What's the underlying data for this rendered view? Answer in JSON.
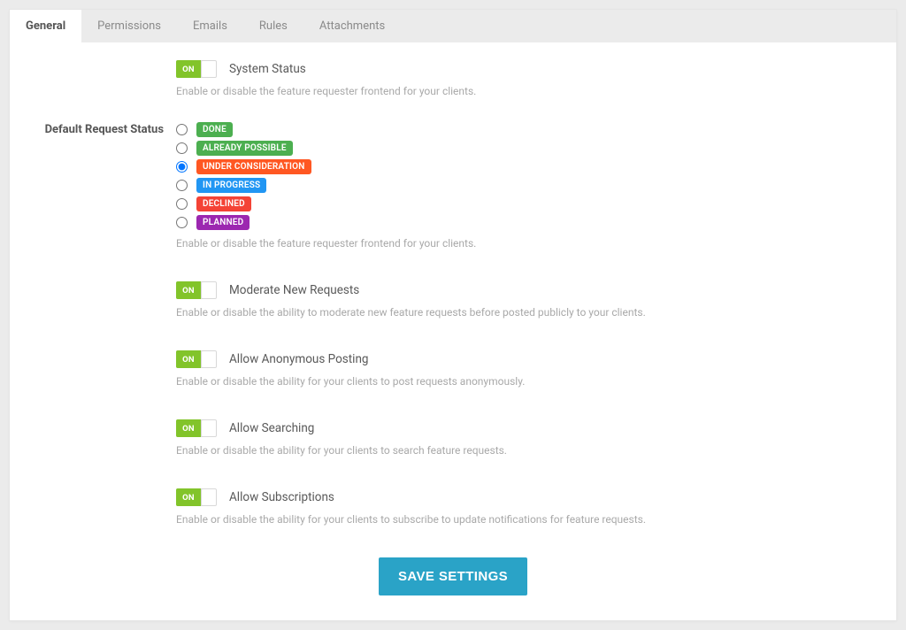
{
  "tabs": {
    "items": [
      {
        "label": "General",
        "active": true
      },
      {
        "label": "Permissions",
        "active": false
      },
      {
        "label": "Emails",
        "active": false
      },
      {
        "label": "Rules",
        "active": false
      },
      {
        "label": "Attachments",
        "active": false
      }
    ]
  },
  "toggle_on_label": "ON",
  "fields": {
    "system_status": {
      "title": "System Status",
      "help": "Enable or disable the feature requester frontend for your clients."
    },
    "default_status": {
      "side_label": "Default Request Status",
      "help": "Enable or disable the feature requester frontend for your clients.",
      "selected": "UNDER CONSIDERATION",
      "options": [
        {
          "label": "DONE",
          "class": "badge-done"
        },
        {
          "label": "ALREADY POSSIBLE",
          "class": "badge-possible"
        },
        {
          "label": "UNDER CONSIDERATION",
          "class": "badge-consider"
        },
        {
          "label": "IN PROGRESS",
          "class": "badge-progress"
        },
        {
          "label": "DECLINED",
          "class": "badge-declined"
        },
        {
          "label": "PLANNED",
          "class": "badge-planned"
        }
      ]
    },
    "moderate": {
      "title": "Moderate New Requests",
      "help": "Enable or disable the ability to moderate new feature requests before posted publicly to your clients."
    },
    "anon": {
      "title": "Allow Anonymous Posting",
      "help": "Enable or disable the ability for your clients to post requests anonymously."
    },
    "search": {
      "title": "Allow Searching",
      "help": "Enable or disable the ability for your clients to search feature requests."
    },
    "subs": {
      "title": "Allow Subscriptions",
      "help": "Enable or disable the ability for your clients to subscribe to update notifications for feature requests."
    }
  },
  "save_button": "SAVE SETTINGS",
  "colors": {
    "accent_green": "#82c42a",
    "accent_blue": "#2aa3c7"
  }
}
